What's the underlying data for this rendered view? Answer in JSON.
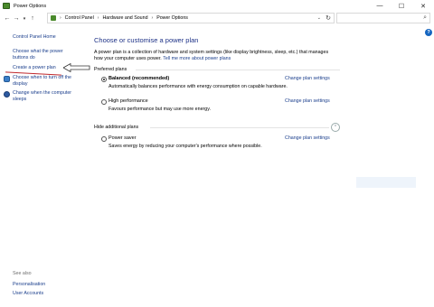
{
  "window": {
    "title": "Power Options",
    "minimize_glyph": "—",
    "maximize_glyph": "☐",
    "close_glyph": "✕",
    "app_icon": "power-options-icon"
  },
  "navigation": {
    "back_glyph": "←",
    "forward_glyph": "→",
    "recent_glyph": "▾",
    "up_glyph": "↑",
    "breadcrumbs": [
      "Control Panel",
      "Hardware and Sound",
      "Power Options"
    ],
    "separator_glyph": "›",
    "dropdown_glyph": "⌄",
    "refresh_glyph": "↻",
    "search_placeholder": "",
    "search_icon": "search-icon",
    "search_glyph": "⌕"
  },
  "sidebar": {
    "home": "Control Panel Home",
    "links": [
      {
        "label": "Choose what the power buttons do",
        "line1": "Choose what the power",
        "line2": "buttons do"
      },
      {
        "label": "Create a power plan"
      },
      {
        "label": "Choose when to turn off the display",
        "line1": "Choose when to turn off the",
        "line2": "display",
        "icon": "display-shield-icon"
      },
      {
        "label": "Change when the computer sleeps",
        "line1": "Change when the computer",
        "line2": "sleeps",
        "icon": "moon-icon"
      }
    ],
    "see_also": "See also",
    "see_also_links": [
      "Personalisation",
      "User Accounts"
    ]
  },
  "main": {
    "heading": "Choose or customise a power plan",
    "description_line1": "A power plan is a collection of hardware and system settings (like display brightness, sleep, etc.) that manages",
    "description_line2": "how your computer uses power.",
    "learn_more": "Tell me more about power plans",
    "preferred_label": "Preferred plans",
    "hidden_label": "Hide additional plans",
    "collapse_glyph": "⌃",
    "plans": [
      {
        "name": "Balanced (recommended)",
        "description": "Automatically balances performance with energy consumption on capable hardware.",
        "selected": true,
        "link": "Change plan settings"
      },
      {
        "name": "High performance",
        "description": "Favours performance but may use more energy.",
        "selected": false,
        "link": "Change plan settings"
      },
      {
        "name": "Power saver",
        "description": "Saves energy by reducing your computer's performance where possible.",
        "selected": false,
        "link": "Change plan settings"
      }
    ]
  },
  "help_glyph": "?",
  "colors": {
    "link": "#1a3e8c",
    "heading": "#1e3287",
    "annotation": "#c0282c"
  }
}
